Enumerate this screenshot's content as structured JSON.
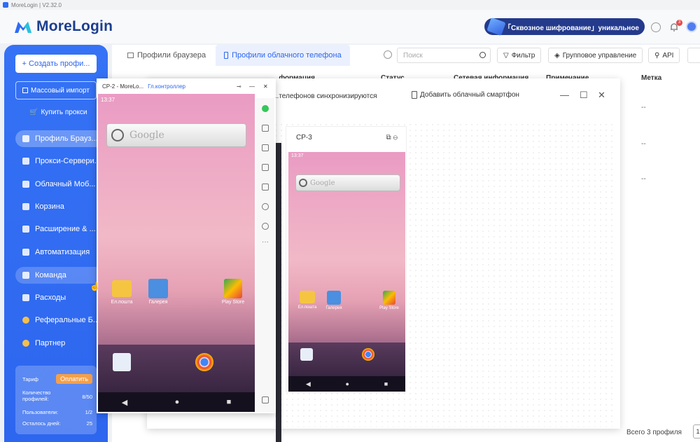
{
  "titlebar": {
    "text": "MoreLogin | V2.32.0"
  },
  "header": {
    "brand": "MoreLogin",
    "promo": "「Сквозное шифрование」уникальное",
    "notif_count": "3"
  },
  "sidebar": {
    "create_btn": "+ Создать профи...",
    "import_btn": "Массовый импорт",
    "buy_proxy": "Купить прокси",
    "items": [
      {
        "label": "Профиль Брауз..."
      },
      {
        "label": "Прокси-Сервери..."
      },
      {
        "label": "Облачный Моб..."
      },
      {
        "label": "Корзина"
      },
      {
        "label": "Расширение & ..."
      },
      {
        "label": "Автоматизация"
      },
      {
        "label": "Команда"
      },
      {
        "label": "Расходы"
      },
      {
        "label": "Реферальные Б..."
      },
      {
        "label": "Партнер"
      }
    ],
    "plan": {
      "tariff_label": "Тариф",
      "pay_btn": "Оплатить",
      "profiles_label": "Количество профилей:",
      "profiles_value": "8/50",
      "users_label": "Пользователи:",
      "users_value": "1/2",
      "days_label": "Осталось дней:",
      "days_value": "25"
    }
  },
  "main": {
    "tabs": [
      {
        "label": "Профили браузера"
      },
      {
        "label": "Профили облачного телефона"
      }
    ],
    "search_placeholder": "Поиск",
    "filter_btn": "Фильтр",
    "group_btn": "Групповое управление",
    "api_btn": "API",
    "columns": {
      "info": "...формация",
      "status": "Статус",
      "network": "Сетевая информация",
      "note": "Примечание",
      "tag": "Метка"
    },
    "row_dash": "--",
    "total": "Всего 3 профиля",
    "page": "1"
  },
  "modal": {
    "sync_text": "...телефонов синхронизируются",
    "add_btn": "Добавить облачный смартфон",
    "card3_title": "CP-3"
  },
  "cp2": {
    "title": "CP-2 - MoreLo...",
    "controller": "Гл.контроллер",
    "time": "13:37",
    "search_hint": "Google"
  },
  "cp3": {
    "time": "13:37",
    "search_hint": "Google"
  },
  "apps": {
    "mail": "Ел.пошта",
    "gallery": "Галерея",
    "play": "Play Store"
  }
}
